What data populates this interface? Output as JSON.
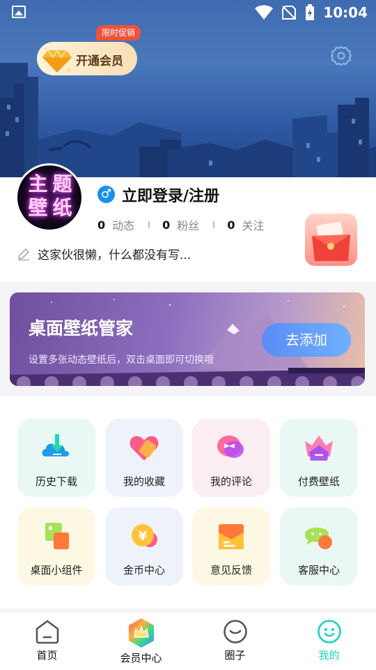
{
  "status_bar": {
    "time": "10:04"
  },
  "header": {
    "vip_label": "开通会员",
    "promo_tag": "限时促销"
  },
  "profile": {
    "avatar_text": [
      "主",
      "题",
      "壁",
      "纸"
    ],
    "login_title": "立即登录/注册",
    "stats": [
      {
        "count": "0",
        "label": "动态"
      },
      {
        "count": "0",
        "label": "粉丝"
      },
      {
        "count": "0",
        "label": "关注"
      }
    ],
    "bio": "这家伙很懒，什么都没有写..."
  },
  "manager": {
    "title": "桌面壁纸管家",
    "subtitle": "设置多张动态壁纸后，双击桌面即可切换哦",
    "add_label": "去添加"
  },
  "grid": [
    {
      "label": "历史下载",
      "icon": "download-cloud-icon",
      "bg": "#eaf8f5"
    },
    {
      "label": "我的收藏",
      "icon": "heart-icon",
      "bg": "#eef3fb"
    },
    {
      "label": "我的评论",
      "icon": "comment-icon",
      "bg": "#fbeef2"
    },
    {
      "label": "付费壁纸",
      "icon": "crown-icon",
      "bg": "#eaf8f5"
    },
    {
      "label": "桌面小组件",
      "icon": "widget-icon",
      "bg": "#fdf8e4"
    },
    {
      "label": "金币中心",
      "icon": "coin-icon",
      "bg": "#eef3fb"
    },
    {
      "label": "意见反馈",
      "icon": "feedback-icon",
      "bg": "#fdf8e4"
    },
    {
      "label": "客服中心",
      "icon": "service-icon",
      "bg": "#eaf8f5"
    }
  ],
  "nav": [
    {
      "label": "首页",
      "icon": "home-icon"
    },
    {
      "label": "会员中心",
      "icon": "vip-crown-icon"
    },
    {
      "label": "圈子",
      "icon": "circle-icon"
    },
    {
      "label": "我的",
      "icon": "me-icon",
      "active": true
    }
  ],
  "colors": {
    "active_nav": "#1ccfc0",
    "accent_blue": "#5b8cf5",
    "promo": "#f2513a"
  }
}
